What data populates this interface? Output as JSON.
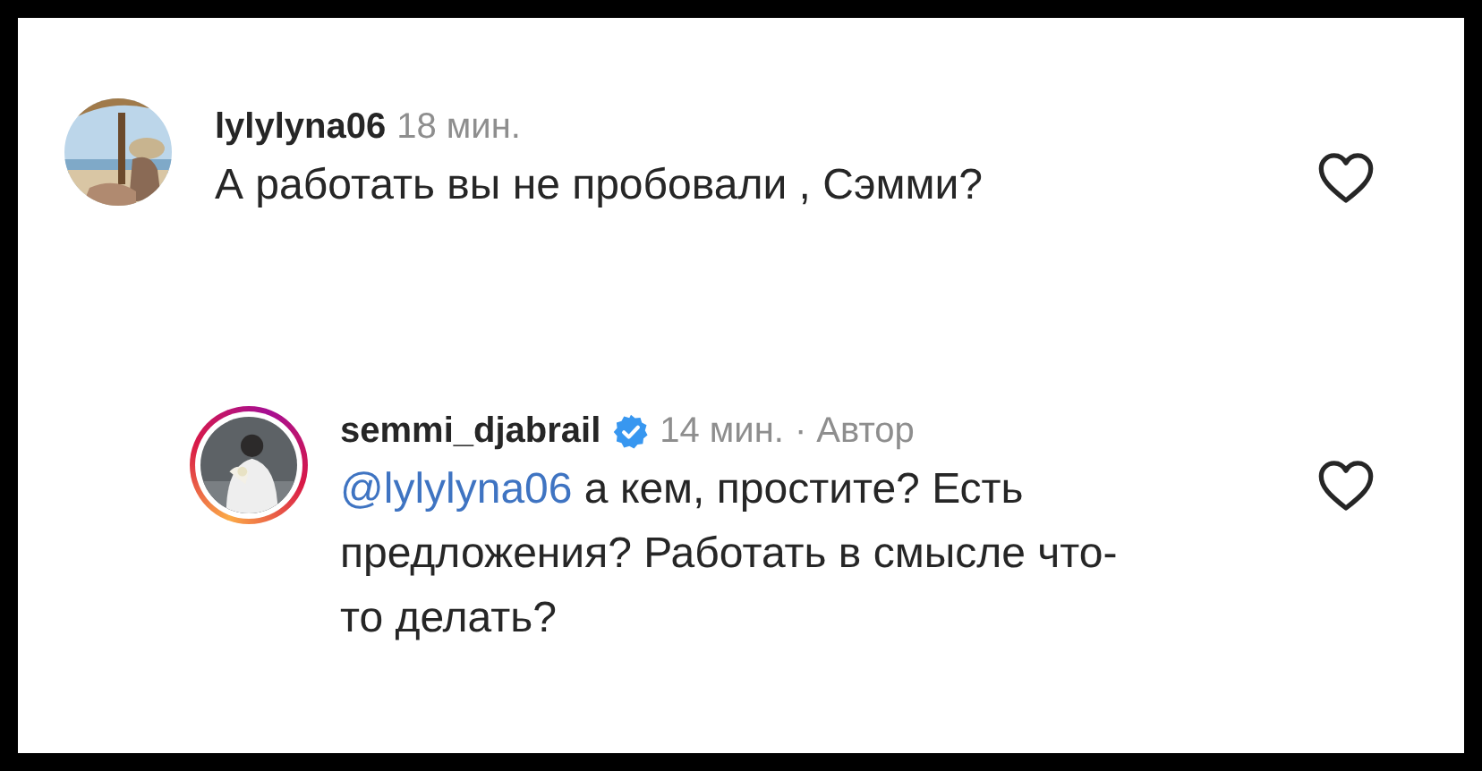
{
  "comments": [
    {
      "username": "lylylyna06",
      "verified": false,
      "story_ring": false,
      "time": "18 мин.",
      "text": "А работать вы не пробовали , Сэмми?",
      "liked": false
    },
    {
      "username": "semmi_djabrail",
      "verified": true,
      "story_ring": true,
      "time": "14 мин.",
      "author_tag": "· Автор",
      "mention": "@lylylyna06",
      "text": "а кем, простите? Есть предложения? Работать в смысле что-то делать?",
      "liked": false
    }
  ]
}
